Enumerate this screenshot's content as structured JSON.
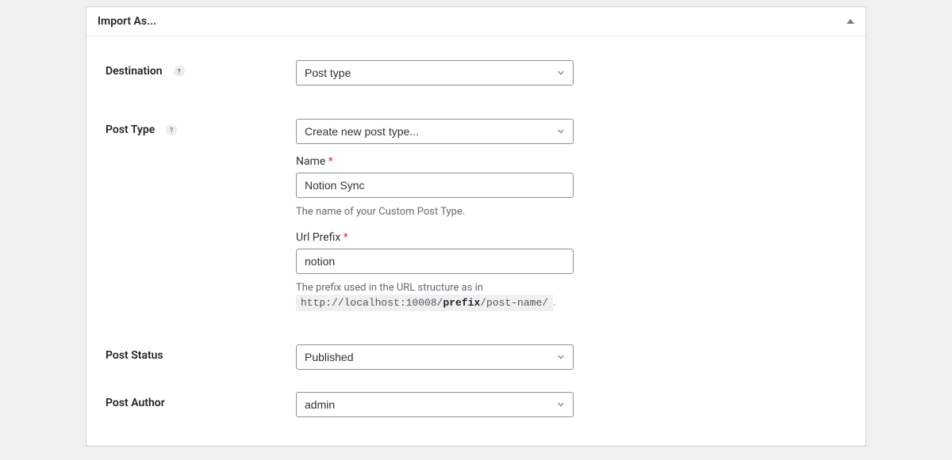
{
  "panel": {
    "title": "Import As..."
  },
  "fields": {
    "destination": {
      "label": "Destination",
      "value": "Post type"
    },
    "postType": {
      "label": "Post Type",
      "value": "Create new post type...",
      "name": {
        "label": "Name",
        "required": "*",
        "value": "Notion Sync",
        "description": "The name of your Custom Post Type."
      },
      "urlPrefix": {
        "label": "Url Prefix",
        "required": "*",
        "value": "notion",
        "descriptionBefore": "The prefix used in the URL structure as in",
        "urlBefore": "http://localhost:10008/",
        "urlBold": "prefix",
        "urlAfter": "/post-name/",
        "punct": "."
      }
    },
    "postStatus": {
      "label": "Post Status",
      "value": "Published"
    },
    "postAuthor": {
      "label": "Post Author",
      "value": "admin"
    }
  }
}
